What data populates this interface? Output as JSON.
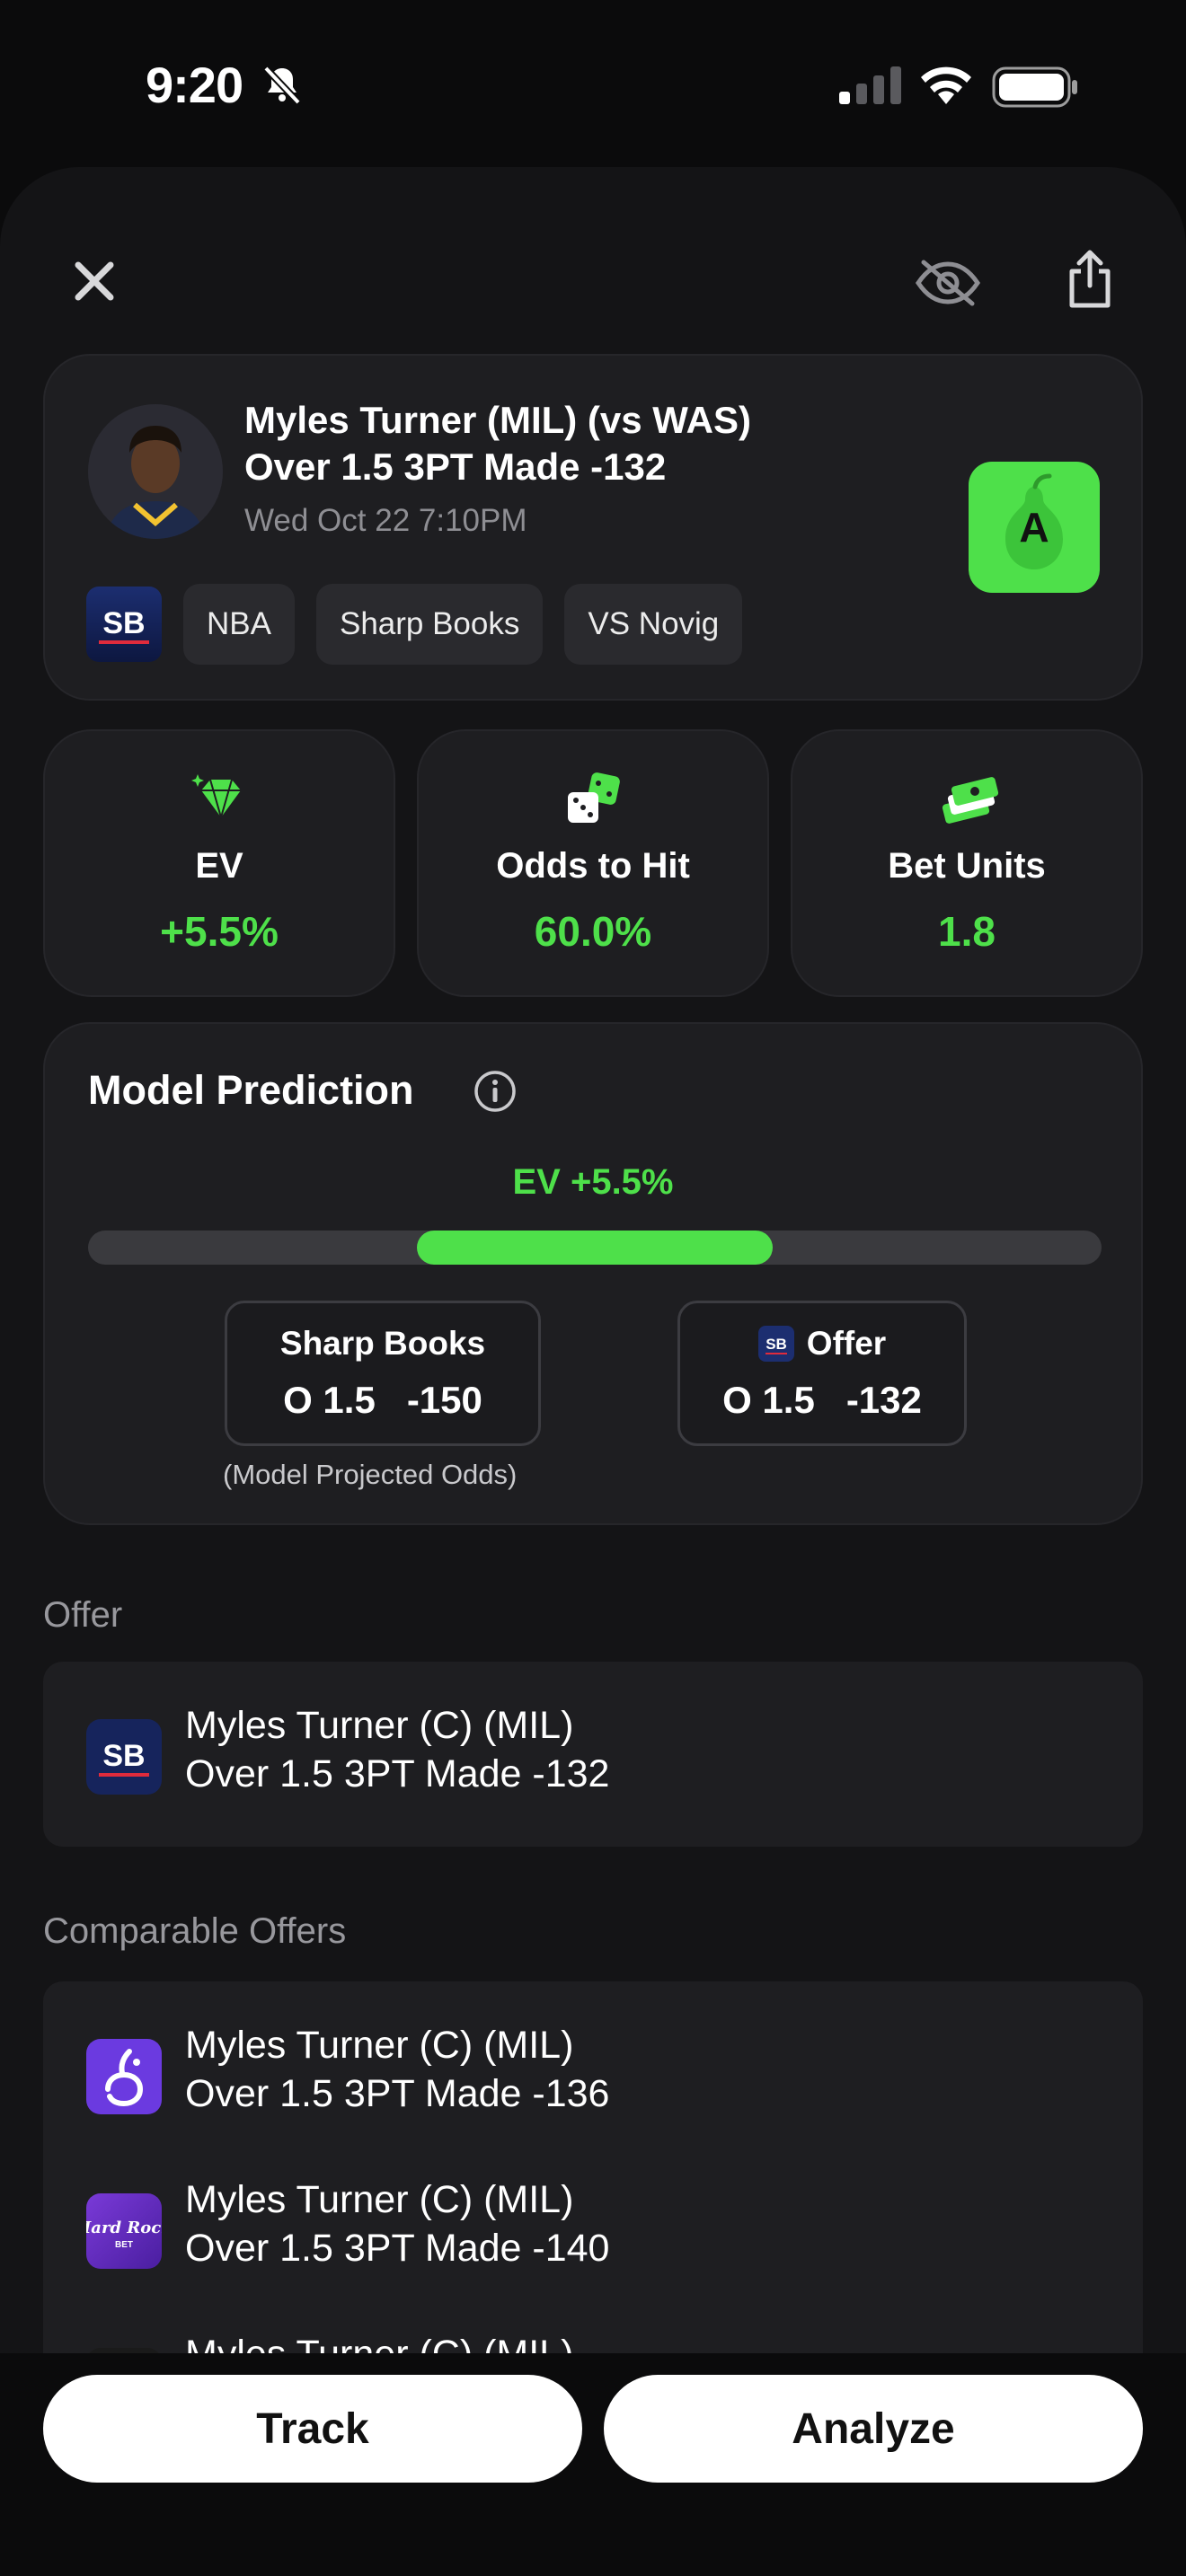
{
  "status_bar": {
    "time": "9:20"
  },
  "colors": {
    "accent": "#4ee04a",
    "background": "#0b0b0c",
    "card": "#1e1e21"
  },
  "bet": {
    "title_line1": "Myles Turner (MIL) (vs WAS)",
    "title_line2": "Over 1.5 3PT Made -132",
    "date": "Wed Oct 22 7:10PM",
    "grade": "A",
    "tags": [
      "NBA",
      "Sharp Books",
      "VS Novig"
    ]
  },
  "stats": [
    {
      "label": "EV",
      "value": "+5.5%",
      "icon": "diamond-icon"
    },
    {
      "label": "Odds to Hit",
      "value": "60.0%",
      "icon": "dice-icon"
    },
    {
      "label": "Bet Units",
      "value": "1.8",
      "icon": "cash-icon"
    }
  ],
  "model": {
    "title": "Model Prediction",
    "ev_label": "EV +5.5%",
    "sharp": {
      "label": "Sharp Books",
      "line": "O 1.5   -150",
      "note": "(Model Projected Odds)"
    },
    "offer": {
      "label": "Offer",
      "line": "O 1.5   -132"
    }
  },
  "offer_section": {
    "header": "Offer",
    "line1": "Myles Turner (C) (MIL)",
    "line2": "Over 1.5 3PT Made -132"
  },
  "comparable": {
    "header": "Comparable Offers",
    "items": [
      {
        "line1": "Myles Turner (C) (MIL)",
        "line2": "Over 1.5 3PT Made -136",
        "icon": "sportsbook-purple-icon"
      },
      {
        "line1": "Myles Turner (C) (MIL)",
        "line2": "Over 1.5 3PT Made -140",
        "icon": "hard-rock-bet-icon"
      },
      {
        "line1": "Myles Turner (C) (MIL)",
        "line2": "",
        "icon": "sportsbook-gold-icon"
      }
    ]
  },
  "hard_rock_logo_text": "Hard Rock",
  "hard_rock_logo_sub": "BET",
  "sb_logo_text": "SB",
  "actions": {
    "track": "Track",
    "analyze": "Analyze"
  }
}
